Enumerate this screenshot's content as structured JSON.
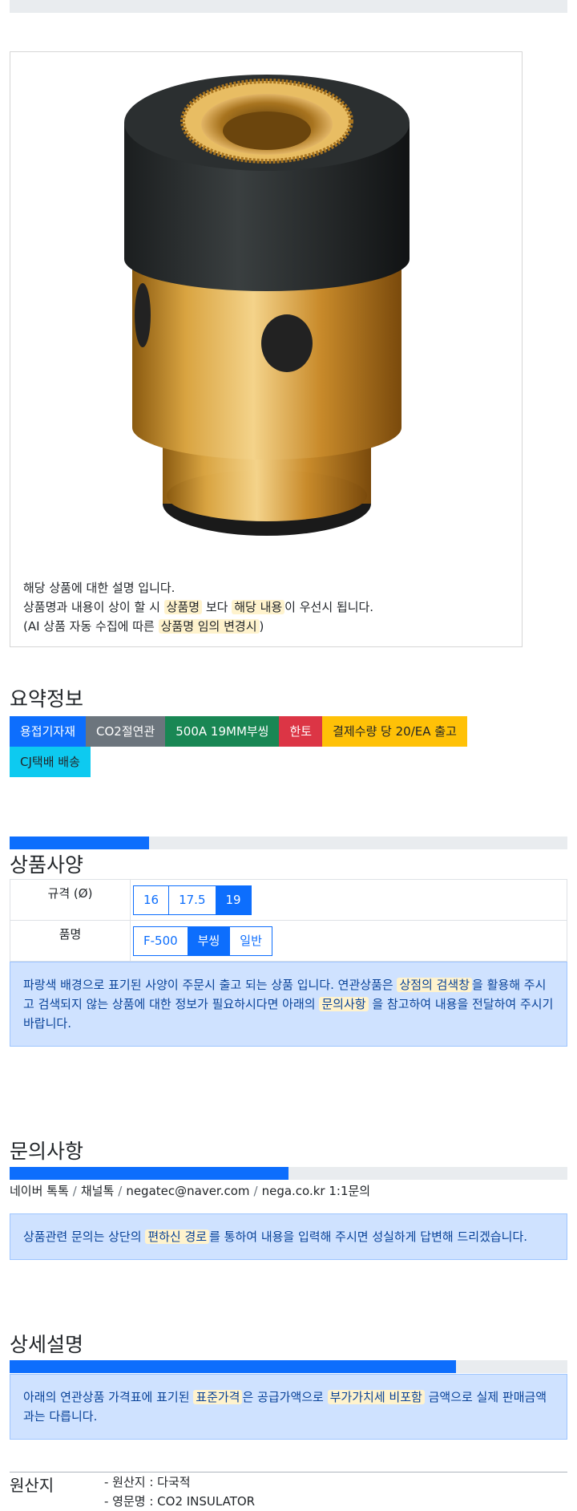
{
  "product": {
    "image_icon": "brass-insulator-photo",
    "desc_line1": "해당 상품에 대한 설명 입니다.",
    "desc_line2_a": "상품명과 내용이 상이 할 시 ",
    "desc_line2_hl1": "상품명",
    "desc_line2_b": " 보다 ",
    "desc_line2_hl2": "해당 내용",
    "desc_line2_c": "이 우선시 됩니다.",
    "desc_line3_a": "(AI 상품 자동 수집에 따른 ",
    "desc_line3_hl": "상품명 임의 변경시",
    "desc_line3_b": ")"
  },
  "summary": {
    "title": "요약정보",
    "badges": [
      "용접기자재",
      "CO2절연관",
      "500A 19MM부씽",
      "한토",
      "결제수량 당 20/EA 출고",
      "CJ택배 배송"
    ]
  },
  "spec": {
    "progress_percent": 25,
    "title": "상품사양",
    "rows": [
      {
        "label": "규격 (Ø)",
        "options": [
          "16",
          "17.5",
          "19"
        ],
        "selected": "19"
      },
      {
        "label": "품명",
        "options": [
          "F-500",
          "부씽",
          "일반"
        ],
        "selected": "부씽"
      }
    ],
    "notice_a": "파랑색 배경으로 표기된 사양이 주문시 출고 되는 상품 입니다. 연관상품은 ",
    "notice_hl1": "상점의 검색창",
    "notice_b": "을 활용해 주시고 검색되지 않는 상품에 대한 정보가 필요하시다면 아래의 ",
    "notice_hl2": "문의사항",
    "notice_c": " 을 참고하여 내용을 전달하여 주시기 바랍니다."
  },
  "inquiry": {
    "title": "문의사항",
    "progress_percent": 50,
    "links": [
      "네이버 톡톡",
      "채널톡",
      "negatec@naver.com",
      "nega.co.kr 1:1문의"
    ],
    "separator": "/",
    "notice_a": "상품관련 문의는 상단의 ",
    "notice_hl": "편하신 경로",
    "notice_b": "를 통하여 내용을 입력해 주시면 성실하게 답변해 드리겠습니다."
  },
  "detail": {
    "title": "상세설명",
    "progress_percent": 80,
    "notice_a": "아래의 연관상품 가격표에 표기된 ",
    "notice_hl1": "표준가격",
    "notice_b": "은 공급가액으로 ",
    "notice_hl2": "부가가치세 비포함",
    "notice_c": " 금액으로 실제 판매금액과는 다릅니다."
  },
  "origin": {
    "label": "원산지",
    "items": [
      "- 원산지 : 다국적",
      "- 영문명 : CO2 INSULATOR"
    ]
  },
  "colors": {
    "primary": "#0d6efd",
    "secondary": "#6c757d",
    "success": "#198754",
    "danger": "#dc3545",
    "warning": "#ffc107",
    "info": "#0dcaf0",
    "alert_bg": "#cfe2ff",
    "highlight": "#fff3cd"
  }
}
